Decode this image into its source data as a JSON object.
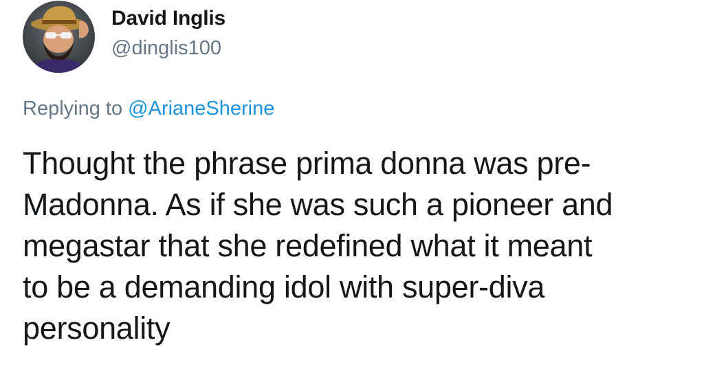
{
  "author": {
    "display_name": "David Inglis",
    "handle": "@dinglis100"
  },
  "reply": {
    "prefix": "Replying to",
    "mention": "@ArianeSherine"
  },
  "tweet": {
    "lines": [
      "Thought the phrase prima donna was pre-",
      "Madonna. As if she was such a pioneer and",
      "megastar that she redefined what it meant",
      "to be a demanding idol with super-diva",
      "personality"
    ]
  },
  "colors": {
    "text": "#14171a",
    "secondary": "#657786",
    "link": "#1b95e0"
  }
}
